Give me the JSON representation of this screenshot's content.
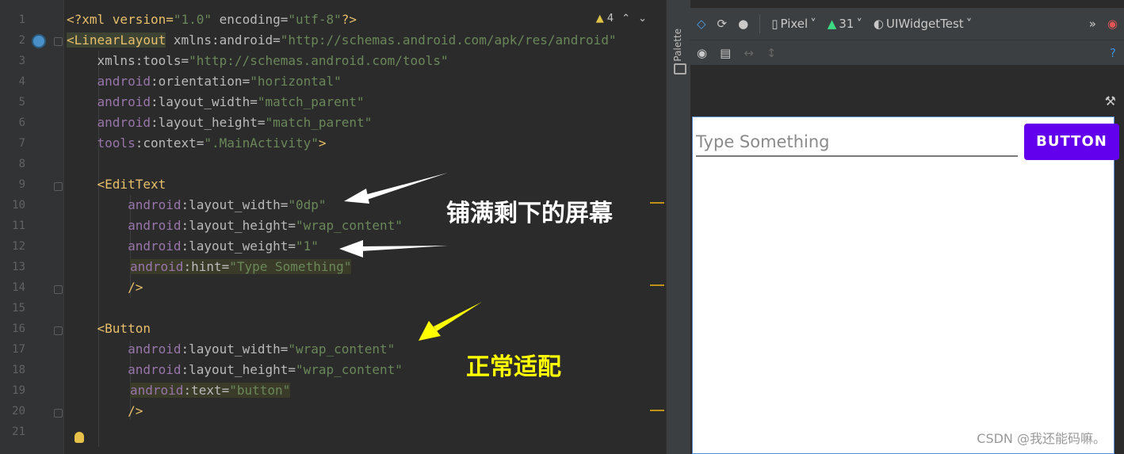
{
  "editor": {
    "line_numbers": [
      "1",
      "2",
      "3",
      "4",
      "5",
      "6",
      "7",
      "8",
      "9",
      "10",
      "11",
      "12",
      "13",
      "14",
      "15",
      "16",
      "17",
      "18",
      "19",
      "20",
      "21"
    ],
    "warning_count": "4",
    "lines": {
      "l1": {
        "a": "<?xml version=",
        "b": "\"1.0\"",
        "c": " encoding=",
        "d": "\"utf-8\"",
        "e": "?>"
      },
      "l2": {
        "tag": "<LinearLayout",
        "ns": " xmlns:android=",
        "val": "\"http://schemas.android.com/apk/res/android\""
      },
      "l3": {
        "ns": "    xmlns:tools=",
        "val": "\"http://schemas.android.com/tools\""
      },
      "l4": {
        "ns": "    android",
        "attr": ":orientation=",
        "val": "\"horizontal\""
      },
      "l5": {
        "ns": "    android",
        "attr": ":layout_width=",
        "val": "\"match_parent\""
      },
      "l6": {
        "ns": "    android",
        "attr": ":layout_height=",
        "val": "\"match_parent\""
      },
      "l7": {
        "ns": "    tools",
        "attr": ":context=",
        "val": "\".MainActivity\"",
        "end": ">"
      },
      "l9": {
        "tag": "    <EditText"
      },
      "l10": {
        "ns": "        android",
        "attr": ":layout_width=",
        "val": "\"0dp\""
      },
      "l11": {
        "ns": "        android",
        "attr": ":layout_height=",
        "val": "\"wrap_content\""
      },
      "l12": {
        "ns": "        android",
        "attr": ":layout_weight=",
        "val": "\"1\""
      },
      "l13": {
        "ns": "android",
        "attr": ":hint=",
        "val": "\"Type Something\""
      },
      "l14": {
        "end": "        />"
      },
      "l16": {
        "tag": "    <Button"
      },
      "l17": {
        "ns": "        android",
        "attr": ":layout_width=",
        "val": "\"wrap_content\""
      },
      "l18": {
        "ns": "        android",
        "attr": ":layout_height=",
        "val": "\"wrap_content\""
      },
      "l19": {
        "ns": "android",
        "attr": ":text=",
        "val": "\"button\""
      },
      "l20": {
        "end": "        />"
      }
    }
  },
  "annotations": {
    "fill_remaining": "铺满剩下的屏幕",
    "normal_fit": "正常适配"
  },
  "palette_label": "Palette",
  "design": {
    "device": "Pixel",
    "api": "31",
    "theme": "UIWidgetTest",
    "edit_hint": "Type Something",
    "button_text": "BUTTON",
    "watermark": "CSDN @我还能码嘛。"
  },
  "colors": {
    "button": "#6200ee",
    "arrow_white": "#ffffff",
    "arrow_yellow": "#ffff00"
  }
}
